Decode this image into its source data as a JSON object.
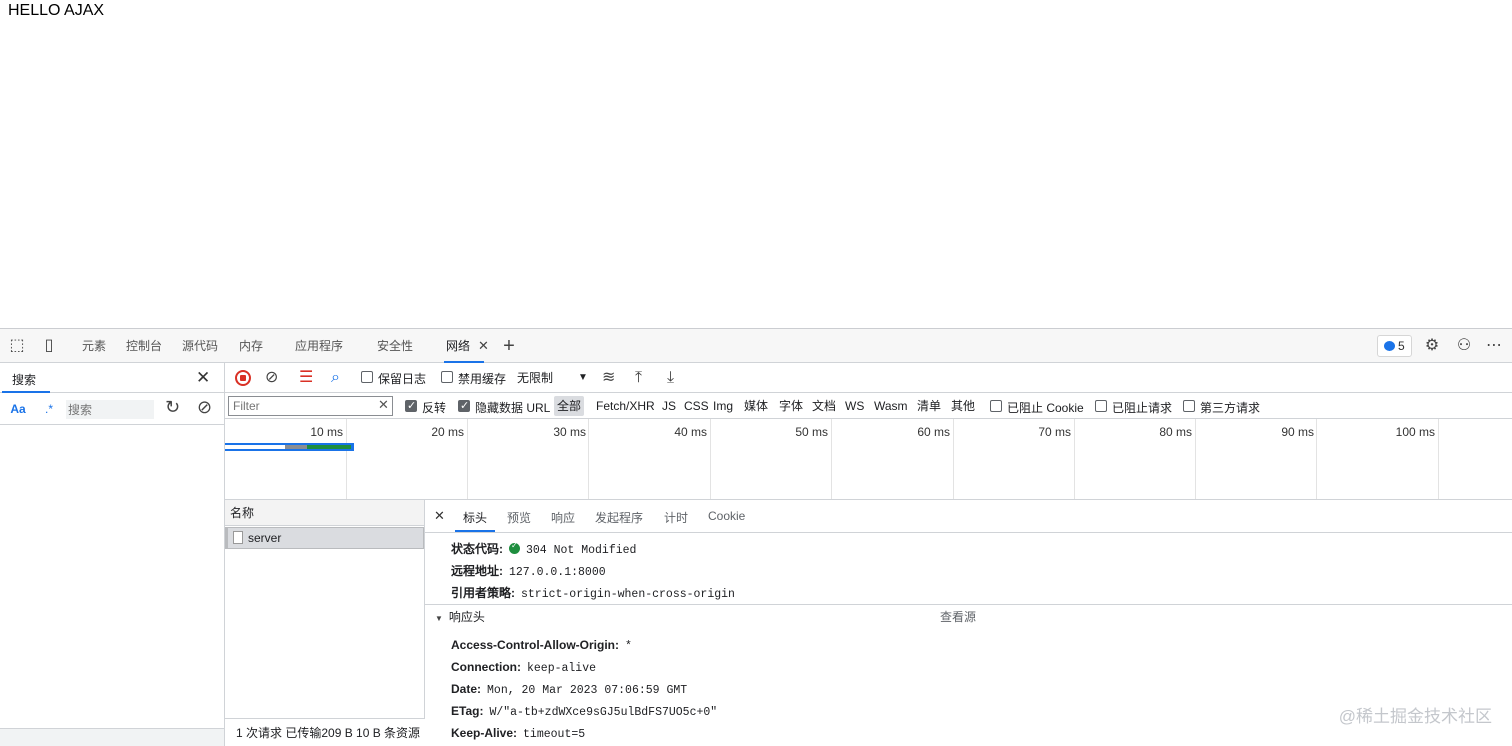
{
  "page": {
    "text": "HELLO AJAX"
  },
  "devtools": {
    "tabs": [
      {
        "label": "元素"
      },
      {
        "label": "控制台"
      },
      {
        "label": "源代码"
      },
      {
        "label": "内存"
      },
      {
        "label": "应用程序"
      },
      {
        "label": "安全性"
      },
      {
        "label": "网络"
      }
    ],
    "issues_count": "5",
    "search_panel": {
      "title": "搜索",
      "match_case": "Aa",
      "regex": ".*",
      "placeholder": "搜索"
    },
    "network": {
      "preserve_log": "保留日志",
      "disable_cache": "禁用缓存",
      "throttling": "无限制",
      "filter_placeholder": "Filter",
      "invert": "反转",
      "hide_data_urls": "隐藏数据 URL",
      "types": [
        "全部",
        "Fetch/XHR",
        "JS",
        "CSS",
        "Img",
        "媒体",
        "字体",
        "文档",
        "WS",
        "Wasm",
        "清单",
        "其他"
      ],
      "blocked_cookies": "已阻止 Cookie",
      "blocked_requests": "已阻止请求",
      "third_party": "第三方请求",
      "timeline_ticks": [
        "10 ms",
        "20 ms",
        "30 ms",
        "40 ms",
        "50 ms",
        "60 ms",
        "70 ms",
        "80 ms",
        "90 ms",
        "100 ms"
      ],
      "name_header": "名称",
      "request_name": "server",
      "summary": "1 次请求  已传输209 B  10 B 条资源",
      "detail_tabs": [
        "标头",
        "预览",
        "响应",
        "发起程序",
        "计时",
        "Cookie"
      ],
      "general": [
        {
          "key": "状态代码:",
          "value": "304 Not Modified"
        },
        {
          "key": "远程地址:",
          "value": "127.0.0.1:8000"
        },
        {
          "key": "引用者策略:",
          "value": "strict-origin-when-cross-origin"
        }
      ],
      "response_headers_title": "响应头",
      "view_source": "查看源",
      "response_headers": [
        {
          "key": "Access-Control-Allow-Origin:",
          "value": "*"
        },
        {
          "key": "Connection:",
          "value": "keep-alive"
        },
        {
          "key": "Date:",
          "value": "Mon, 20 Mar 2023 07:06:59 GMT"
        },
        {
          "key": "ETag:",
          "value": "W/\"a-tb+zdWXce9sGJ5ulBdFS7UO5c+0\""
        },
        {
          "key": "Keep-Alive:",
          "value": "timeout=5"
        }
      ]
    }
  },
  "watermark": "@稀土掘金技术社区"
}
